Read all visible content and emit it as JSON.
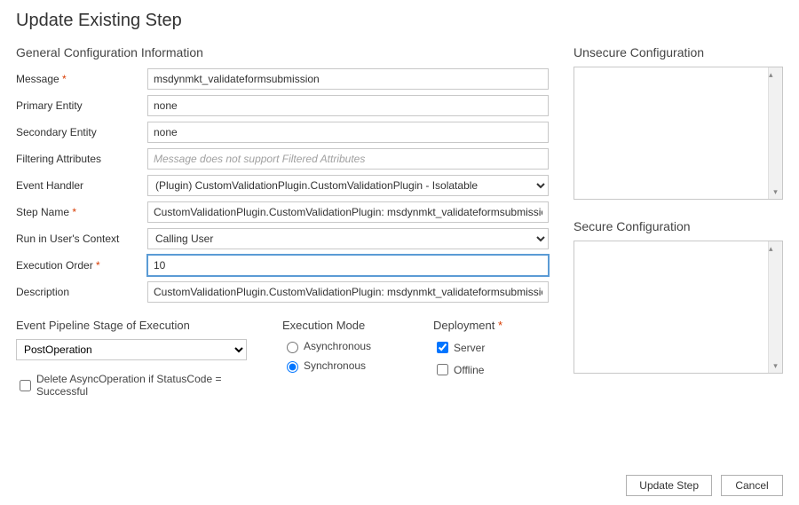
{
  "title": "Update Existing Step",
  "general": {
    "heading": "General Configuration Information",
    "message_label": "Message",
    "message_value": "msdynmkt_validateformsubmission",
    "primary_entity_label": "Primary Entity",
    "primary_entity_value": "none",
    "secondary_entity_label": "Secondary Entity",
    "secondary_entity_value": "none",
    "filtering_label": "Filtering Attributes",
    "filtering_placeholder": "Message does not support Filtered Attributes",
    "event_handler_label": "Event Handler",
    "event_handler_value": "(Plugin) CustomValidationPlugin.CustomValidationPlugin - Isolatable",
    "step_name_label": "Step Name",
    "step_name_value": "CustomValidationPlugin.CustomValidationPlugin: msdynmkt_validateformsubmission of any Ent",
    "run_context_label": "Run in User's Context",
    "run_context_value": "Calling User",
    "exec_order_label": "Execution Order",
    "exec_order_value": "10",
    "description_label": "Description",
    "description_value": "CustomValidationPlugin.CustomValidationPlugin: msdynmkt_validateformsubmission of any Ent"
  },
  "pipeline": {
    "heading": "Event Pipeline Stage of Execution",
    "stage_value": "PostOperation"
  },
  "execution_mode": {
    "heading": "Execution Mode",
    "async_label": "Asynchronous",
    "sync_label": "Synchronous",
    "selected": "sync"
  },
  "deployment": {
    "heading": "Deployment",
    "server_label": "Server",
    "server_checked": true,
    "offline_label": "Offline",
    "offline_checked": false
  },
  "delete_async_label": "Delete AsyncOperation if StatusCode = Successful",
  "delete_async_checked": false,
  "unsecure": {
    "heading": "Unsecure  Configuration",
    "value": ""
  },
  "secure": {
    "heading": "Secure  Configuration",
    "value": ""
  },
  "buttons": {
    "update": "Update Step",
    "cancel": "Cancel"
  }
}
